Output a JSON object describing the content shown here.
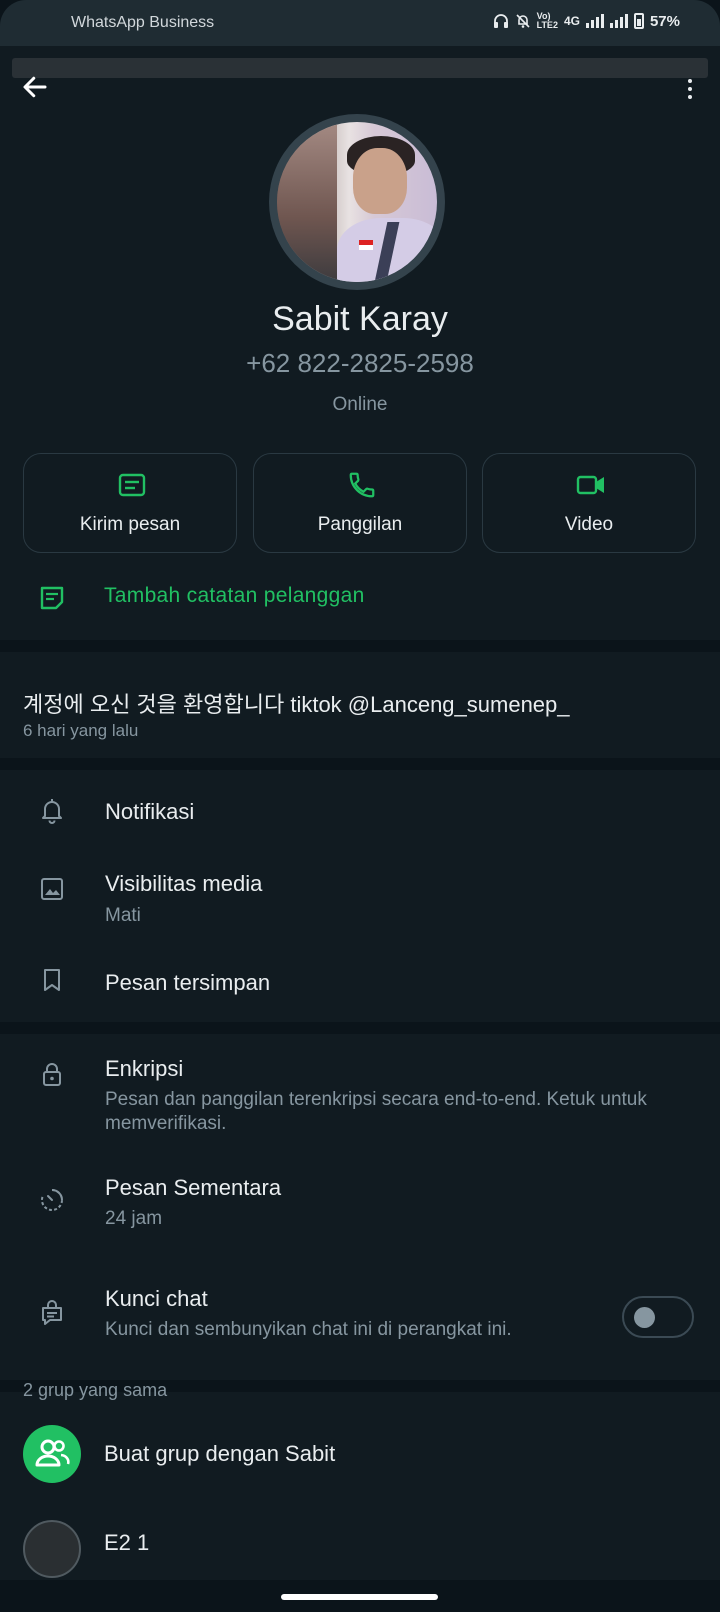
{
  "status_bar": {
    "app_name": "WhatsApp Business",
    "network_label_top": "Vo)",
    "network_label_bottom": "LTE2",
    "network_type": "4G",
    "battery": "57%"
  },
  "toolbar": {
    "back_icon": "arrow-left-icon",
    "menu_icon": "more-vertical-icon"
  },
  "contact": {
    "name": "Sabit Karay",
    "phone": "+62 822-2825-2598",
    "status": "Online"
  },
  "actions": [
    {
      "label": "Kirim pesan",
      "icon": "message-icon"
    },
    {
      "label": "Panggilan",
      "icon": "phone-icon"
    },
    {
      "label": "Video",
      "icon": "video-icon"
    }
  ],
  "customer_note": {
    "label": "Tambah catatan pelanggan",
    "icon": "note-icon"
  },
  "about": {
    "text": "계정에 오신 것을 환영합니다 tiktok @Lanceng_sumenep_",
    "time": "6 hari yang lalu"
  },
  "settings": {
    "notifications": {
      "title": "Notifikasi",
      "icon": "bell-icon"
    },
    "media_visibility": {
      "title": "Visibilitas media",
      "subtitle": "Mati",
      "icon": "image-icon"
    },
    "saved_messages": {
      "title": "Pesan tersimpan",
      "icon": "bookmark-icon"
    }
  },
  "privacy": {
    "encryption": {
      "title": "Enkripsi",
      "subtitle": "Pesan dan panggilan terenkripsi secara end-to-end. Ketuk untuk memverifikasi.",
      "icon": "lock-icon"
    },
    "disappearing": {
      "title": "Pesan Sementara",
      "subtitle": "24 jam",
      "icon": "timer-icon"
    },
    "chat_lock": {
      "title": "Kunci chat",
      "subtitle": "Kunci dan sembunyikan chat ini di perangkat ini.",
      "icon": "chat-lock-icon",
      "enabled": false
    }
  },
  "groups": {
    "header": "2 grup yang sama",
    "create_group": "Buat grup dengan Sabit",
    "next_group_partial": "E2 1"
  },
  "colors": {
    "accent": "#21c063",
    "background": "#0b141a",
    "surface": "#111b21",
    "secondary_text": "#8696a0"
  }
}
